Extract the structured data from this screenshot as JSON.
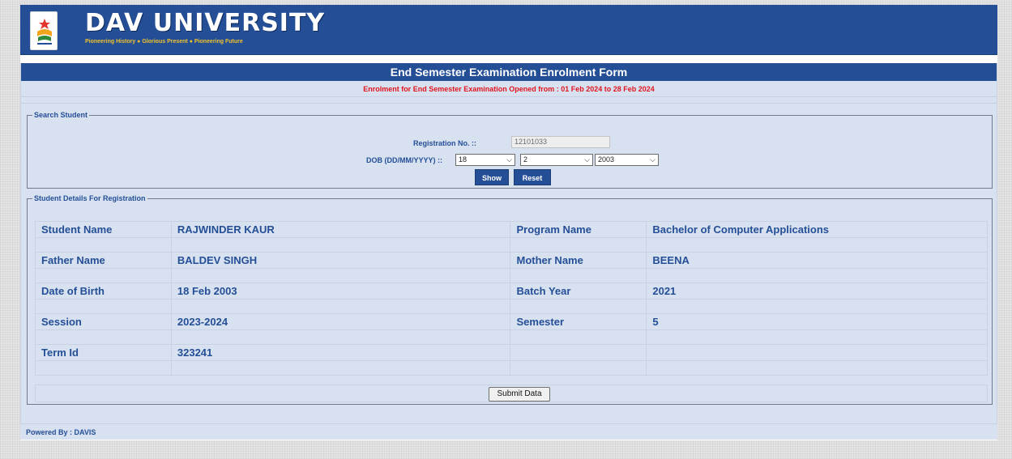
{
  "header": {
    "brand_name": "DAV UNIVERSITY",
    "tagline": "Pioneering History ● Glorious Present ● Pioneering Future",
    "logo_icon": "university-crest-icon"
  },
  "form": {
    "title": "End Semester Examination Enrolment Form",
    "notice": "Enrolment for End Semester Examination Opened from : 01 Feb 2024 to 28 Feb 2024"
  },
  "search": {
    "legend": "Search Student",
    "reg_label": "Registration No. ::",
    "reg_value": "12101033",
    "dob_label": "DOB (DD/MM/YYYY) ::",
    "dob_day": "18",
    "dob_month": "2",
    "dob_year": "2003",
    "show_label": "Show",
    "reset_label": "Reset"
  },
  "details": {
    "legend": "Student Details For Registration",
    "rows": [
      {
        "label1": "Student Name",
        "value1": "RAJWINDER KAUR",
        "label2": "Program Name",
        "value2": "Bachelor of Computer Applications"
      },
      {
        "label1": "Father Name",
        "value1": "BALDEV SINGH",
        "label2": "Mother Name",
        "value2": "BEENA"
      },
      {
        "label1": "Date of Birth",
        "value1": "18 Feb 2003",
        "label2": "Batch Year",
        "value2": "2021"
      },
      {
        "label1": "Session",
        "value1": "2023-2024",
        "label2": "Semester",
        "value2": "5"
      },
      {
        "label1": "Term Id",
        "value1": "323241",
        "label2": "",
        "value2": ""
      }
    ],
    "submit_label": "Submit Data"
  },
  "footer": {
    "text": "Powered By : DAVIS"
  },
  "colors": {
    "primary": "#244f97",
    "notice": "#e0141e",
    "panel": "#d8e1f0",
    "tagline": "#f2c22b"
  }
}
